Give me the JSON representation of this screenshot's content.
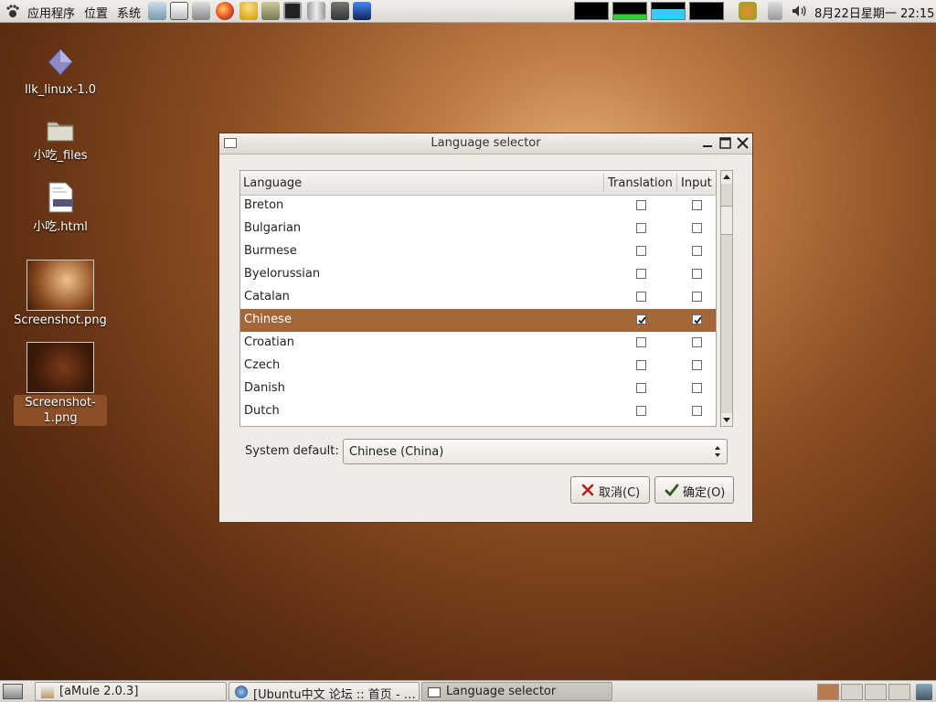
{
  "top_panel": {
    "menus": [
      "应用程序",
      "位置",
      "系统"
    ],
    "launchers": [
      "mail-icon",
      "text-editor-icon",
      "panel-icon",
      "firefox-icon",
      "gaim-icon",
      "notes-icon",
      "terminal-icon",
      "network-icon",
      "camera-icon",
      "bird-icon"
    ],
    "clock": "8月22日星期一 22:15"
  },
  "desktop": {
    "icons": [
      {
        "label": "llk_linux-1.0",
        "icon": "diamond-icon"
      },
      {
        "label": "小吃_files",
        "icon": "folder-icon"
      },
      {
        "label": "小吃.html",
        "icon": "html-file-icon"
      },
      {
        "label": "Screenshot.png",
        "icon": "image-thumbnail-icon"
      },
      {
        "label": "Screenshot-1.png",
        "icon": "image-thumbnail-icon"
      }
    ]
  },
  "dialog": {
    "title": "Language selector",
    "columns": {
      "language": "Language",
      "translation": "Translation",
      "input": "Input"
    },
    "rows": [
      {
        "language": "Breton",
        "translation": false,
        "input": false
      },
      {
        "language": "Bulgarian",
        "translation": false,
        "input": false
      },
      {
        "language": "Burmese",
        "translation": false,
        "input": false
      },
      {
        "language": "Byelorussian",
        "translation": false,
        "input": false
      },
      {
        "language": "Catalan",
        "translation": false,
        "input": false
      },
      {
        "language": "Chinese",
        "translation": true,
        "input": true,
        "selected": true
      },
      {
        "language": "Croatian",
        "translation": false,
        "input": false
      },
      {
        "language": "Czech",
        "translation": false,
        "input": false
      },
      {
        "language": "Danish",
        "translation": false,
        "input": false
      },
      {
        "language": "Dutch",
        "translation": false,
        "input": false
      }
    ],
    "system_default_label": "System default:",
    "system_default_value": "Chinese (China)",
    "cancel_label": "取消(C)",
    "ok_label": "确定(O)"
  },
  "taskbar": {
    "tasks": [
      {
        "label": "[aMule 2.0.3]",
        "active": false
      },
      {
        "label": "[Ubuntu中文 论坛 :: 首页 - …",
        "active": false
      },
      {
        "label": "Language selector",
        "active": true
      }
    ]
  },
  "colors": {
    "selection": "#a5673a",
    "desktop": "#8d4f24"
  }
}
